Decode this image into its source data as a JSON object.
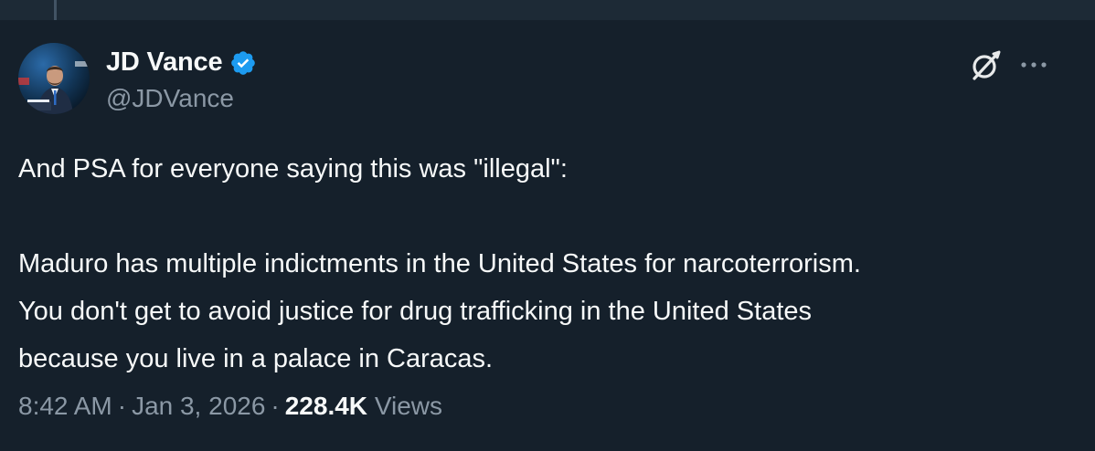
{
  "author": {
    "name": "JD Vance",
    "handle": "@JDVance",
    "verified": true,
    "verified_color": "#1d9bf0"
  },
  "actions": {
    "grok_icon": "grok-icon",
    "more_label": "···"
  },
  "post": {
    "lines": [
      "And PSA for everyone saying this was \"illegal\":",
      "Maduro has multiple indictments in the United States for narcoterrorism.",
      "You don't get to avoid justice for drug trafficking in the United States",
      "because you live in a palace in Caracas."
    ]
  },
  "meta": {
    "time": "8:42 AM",
    "separator": "·",
    "date": "Jan 3, 2026",
    "views_count": "228.4K",
    "views_label": "Views"
  },
  "colors": {
    "background": "#15202b",
    "text": "#f7f9f9",
    "secondary_text": "#8b98a5",
    "accent": "#1d9bf0"
  }
}
